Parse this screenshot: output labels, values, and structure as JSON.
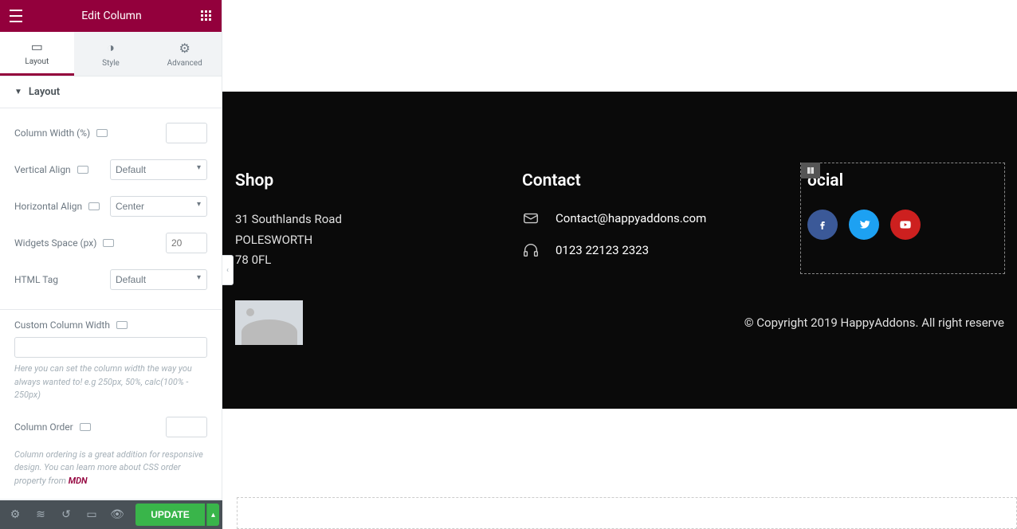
{
  "sidebar": {
    "title": "Edit Column",
    "tabs": {
      "layout": "Layout",
      "style": "Style",
      "advanced": "Advanced"
    },
    "section_layout": "Layout",
    "controls": {
      "column_width_label": "Column Width (%)",
      "column_width_value": "",
      "vertical_align_label": "Vertical Align",
      "vertical_align_value": "Default",
      "horizontal_align_label": "Horizontal Align",
      "horizontal_align_value": "Center",
      "widgets_space_label": "Widgets Space (px)",
      "widgets_space_placeholder": "20",
      "html_tag_label": "HTML Tag",
      "html_tag_value": "Default",
      "custom_width_label": "Custom Column Width",
      "custom_width_value": "",
      "custom_width_hint": "Here you can set the column width the way you always wanted to! e.g 250px, 50%, calc(100% - 250px)",
      "column_order_label": "Column Order",
      "column_order_value": "",
      "column_order_hint_pre": "Column ordering is a great addition for responsive design. You can learn more about CSS order property from ",
      "column_order_hint_link": "MDN"
    },
    "update_button": "UPDATE"
  },
  "footer": {
    "shop": {
      "heading": "Shop",
      "address_line1": "31 Southlands Road",
      "address_line2": "POLESWORTH",
      "address_line3": "78 0FL"
    },
    "contact": {
      "heading": "Contact",
      "email": "Contact@happyaddons.com",
      "phone": "0123 22123 2323"
    },
    "social": {
      "heading": "ocial"
    },
    "copyright": "© Copyright 2019 HappyAddons. All right reserve"
  }
}
